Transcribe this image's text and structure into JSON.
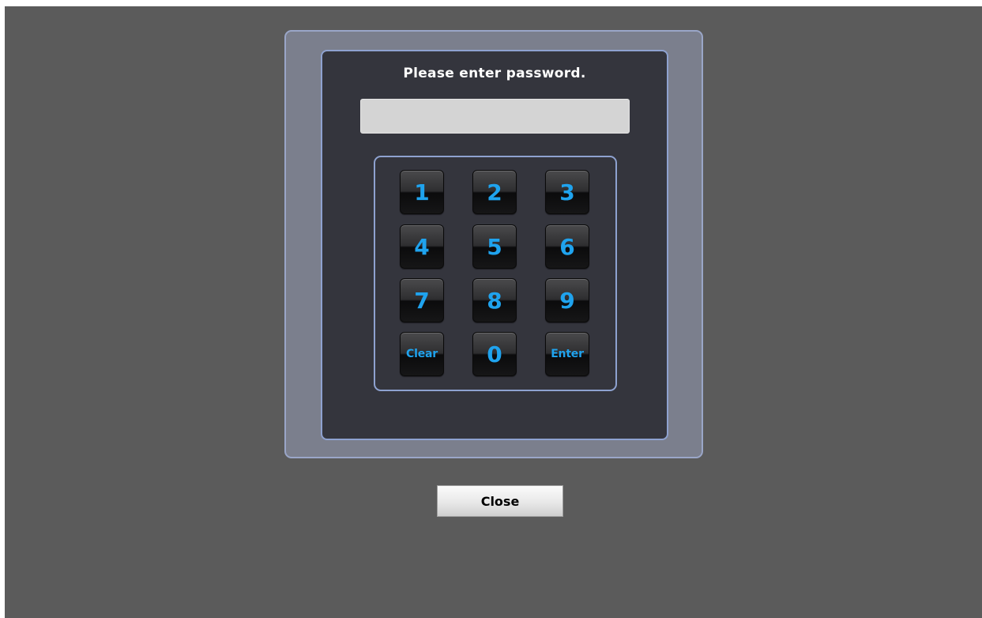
{
  "dialog": {
    "prompt": "Please enter password.",
    "password_value": ""
  },
  "keypad": {
    "keys": [
      "1",
      "2",
      "3",
      "4",
      "5",
      "6",
      "7",
      "8",
      "9",
      "Clear",
      "0",
      "Enter"
    ]
  },
  "footer": {
    "close_label": "Close"
  },
  "colors": {
    "background": "#5b5b5b",
    "frame": "#7b7f8d",
    "panel": "#34353d",
    "accent_border": "#8ea2d0",
    "key_text": "#1fa3ee",
    "field": "#d4d4d4"
  }
}
